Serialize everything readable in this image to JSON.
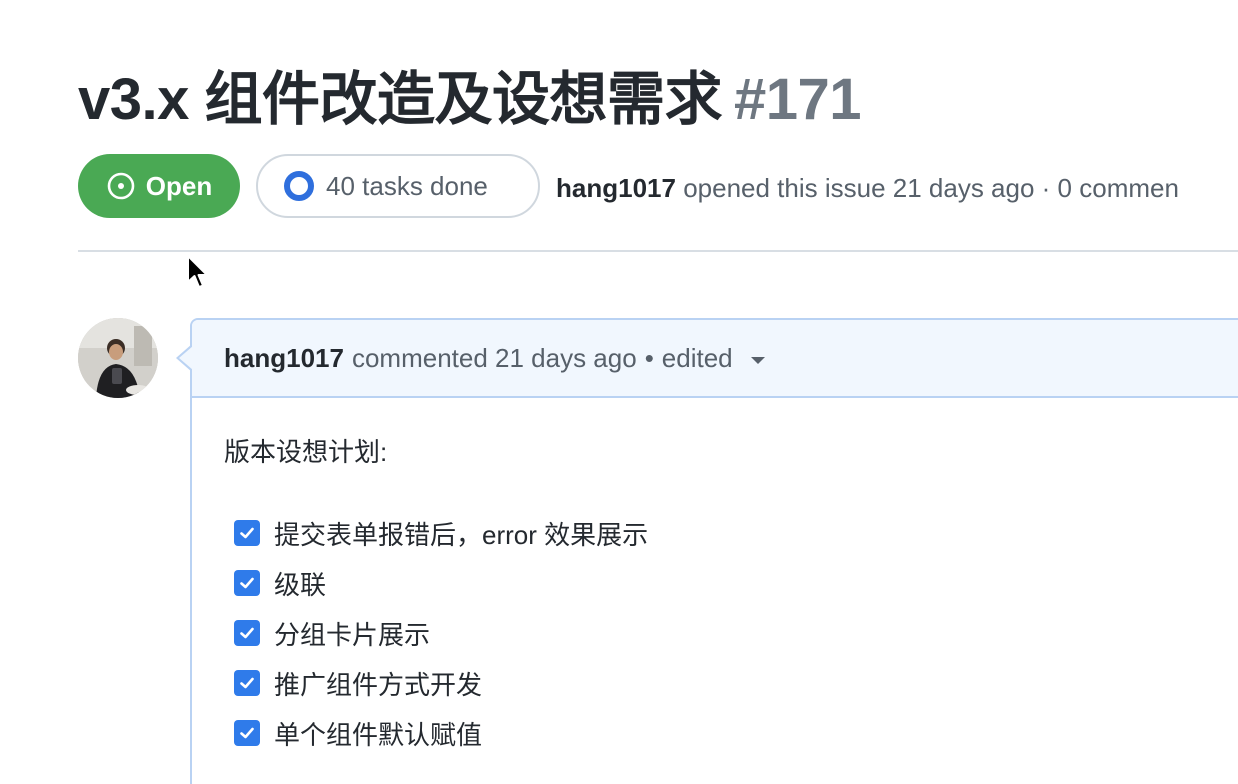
{
  "issue": {
    "title": "v3.x 组件改造及设想需求",
    "number": "#171",
    "state": "Open",
    "tasks_done": "40 tasks done",
    "author": "hang1017",
    "opened_text": "opened this issue 21 days ago · 0 commen"
  },
  "comment": {
    "author": "hang1017",
    "action": "commented 21 days ago",
    "separator": "•",
    "edited": "edited",
    "intro": "版本设想计划:",
    "tasks": [
      {
        "label": "提交表单报错后，error 效果展示",
        "checked": true
      },
      {
        "label": "级联",
        "checked": true
      },
      {
        "label": "分组卡片展示",
        "checked": true
      },
      {
        "label": "推广组件方式开发",
        "checked": true
      },
      {
        "label": "单个组件默认赋值",
        "checked": true
      }
    ]
  },
  "colors": {
    "open_green": "#4aa954",
    "progress_blue": "#2f6fdd",
    "checkbox_blue": "#2f7bea",
    "comment_header_bg": "#f1f7fe",
    "comment_border": "#b9d2f3"
  }
}
